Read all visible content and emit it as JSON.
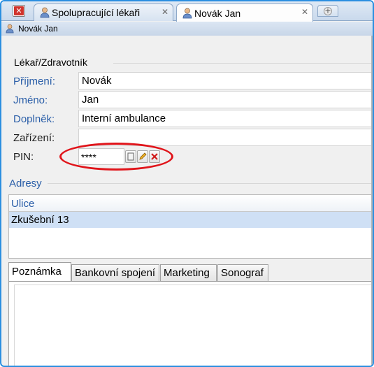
{
  "tabs": [
    {
      "label": "Spolupracující lékaři",
      "icon": "person-icon",
      "active": false
    },
    {
      "label": "Novák Jan",
      "icon": "person-icon",
      "active": true
    }
  ],
  "doc_title": "Novák Jan",
  "form": {
    "group_title": "Lékař/Zdravotník",
    "fields": [
      {
        "label": "Příjmení:",
        "value": "Novák"
      },
      {
        "label": "Jméno:",
        "value": "Jan"
      },
      {
        "label": "Doplněk:",
        "value": "Interní ambulance"
      },
      {
        "label": "Zařízení:",
        "value": ""
      }
    ],
    "pin": {
      "label": "PIN:",
      "value": "****"
    }
  },
  "addresses": {
    "title": "Adresy",
    "columns": [
      "Ulice"
    ],
    "rows": [
      [
        "Zkušební 13"
      ]
    ]
  },
  "bottom_tabs": [
    "Poznámka",
    "Bankovní spojení",
    "Marketing",
    "Sonograf"
  ],
  "colors": {
    "accent": "#2a5ea8",
    "highlight_circle": "#e0141a",
    "selected_row": "#cfe0f5"
  }
}
